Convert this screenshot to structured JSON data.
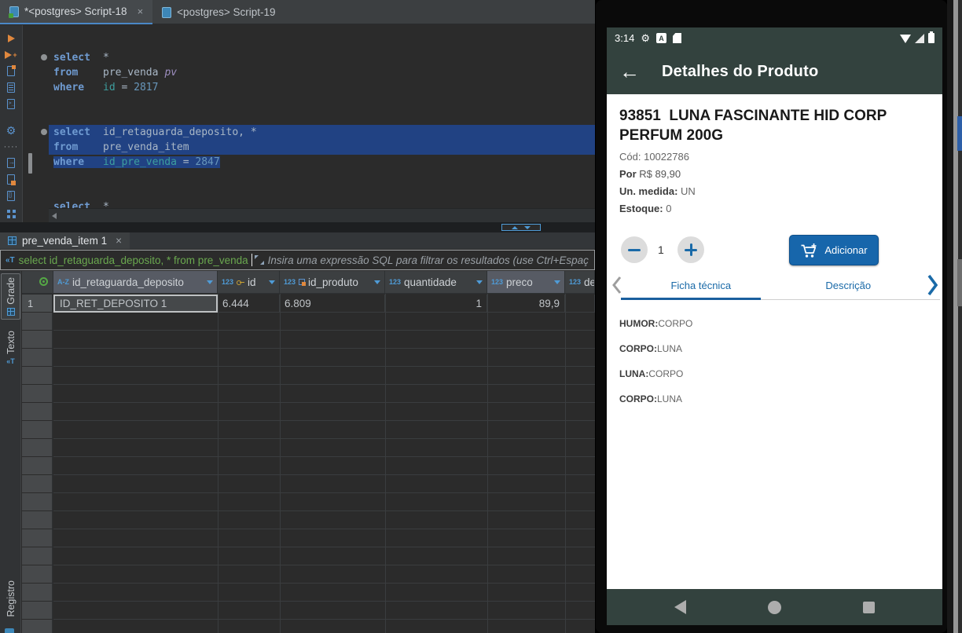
{
  "colors": {
    "accent_blue": "#1766ab",
    "ide_selection": "#214283",
    "filter_green": "#6aa84f",
    "phone_bar": "#33423e",
    "tab_underline": "#4a88c7"
  },
  "ide": {
    "tabs": {
      "tab1": "*<postgres> Script-18",
      "tab2": "<postgres> Script-19",
      "close": "×"
    },
    "sql": {
      "kw_select": "select",
      "kw_from": "from",
      "kw_where": "where",
      "q1_star": "*",
      "q1_table": "pre_venda",
      "q1_alias": "pv",
      "q1_col": "id",
      "q1_eq": " = ",
      "q1_val": "2817",
      "q2_cols": "id_retaguarda_deposito, *",
      "q2_table": "pre_venda_item",
      "q2_col": "id_pre_venda",
      "q2_eq": " = ",
      "q2_val": "2847",
      "q3_star": "*"
    }
  },
  "results": {
    "tab": "pre_venda_item 1",
    "close": "×",
    "filter_query": "select id_retaguarda_deposito, * from pre_venda",
    "filter_placeholder": "Insira uma expressão SQL para filtrar os resultados (use Ctrl+Espaç",
    "side_tabs": {
      "grade": "Grade",
      "texto": "Texto",
      "registro": "Registro"
    },
    "col_type_text": "A-Z",
    "col_type_num": "123",
    "columns": {
      "c1": "id_retaguarda_deposito",
      "c2": "id",
      "c3": "id_produto",
      "c4": "quantidade",
      "c5": "preco",
      "c6": "de"
    },
    "row1": {
      "num": "1",
      "c1": "ID_RET_DEPOSITO 1",
      "c2": "6.444",
      "c3": "6.809",
      "c4": "1",
      "c5": "89,9"
    }
  },
  "phone": {
    "time": "3:14",
    "appbar_title": "Detalhes do Produto",
    "product_title": "93851  LUNA FASCINANTE HID CORP PERFUM 200G",
    "code_label": "Cód:",
    "code_value": "10022786",
    "price_label": "Por",
    "price_value": "R$ 89,90",
    "unit_label": "Un. medida:",
    "unit_value": "UN",
    "stock_label": "Estoque:",
    "stock_value": "0",
    "qty": "1",
    "add_label": "Adicionar",
    "tab_ficha": "Ficha técnica",
    "tab_descricao": "Descrição",
    "abox_letter": "A",
    "specs": [
      {
        "label": "HUMOR:",
        "value": "CORPO"
      },
      {
        "label": "CORPO:",
        "value": "LUNA"
      },
      {
        "label": "LUNA:",
        "value": "CORPO"
      },
      {
        "label": "CORPO:",
        "value": "LUNA"
      }
    ]
  }
}
